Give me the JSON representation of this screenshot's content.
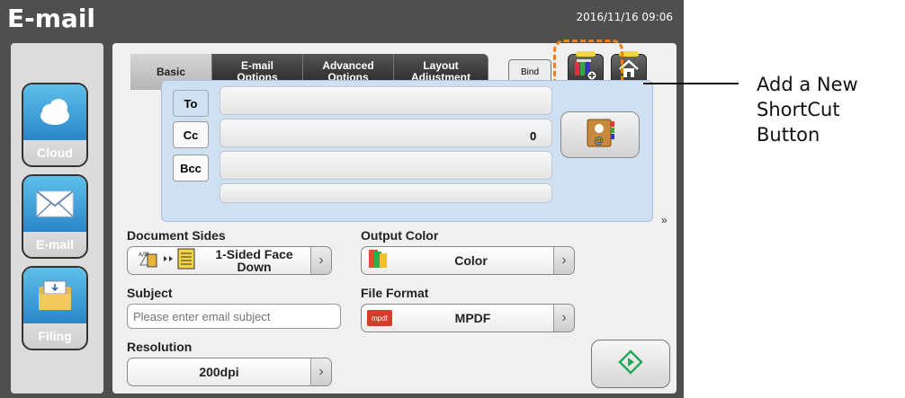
{
  "header": {
    "title": "E-mail",
    "datetime": "2016/11/16 09:06"
  },
  "sidebar": {
    "items": [
      {
        "label": "Cloud",
        "icon": "cloud-icon"
      },
      {
        "label": "E-mail",
        "icon": "envelope-icon"
      },
      {
        "label": "Filing",
        "icon": "folder-icon"
      }
    ]
  },
  "tabs": [
    {
      "label": "Basic",
      "active": true
    },
    {
      "label": "E-mail\nOptions",
      "active": false
    },
    {
      "label": "Advanced\nOptions",
      "active": false
    },
    {
      "label": "Layout\nAdjustment",
      "active": false
    }
  ],
  "toolbar": {
    "bind_label": "Bind",
    "shortcut_icon": "add-shortcut-icon",
    "home_icon": "home-icon"
  },
  "recipients": {
    "to_label": "To",
    "cc_label": "Cc",
    "bcc_label": "Bcc",
    "count": "0",
    "address_book_icon": "address-book-icon"
  },
  "document_sides": {
    "label": "Document Sides",
    "value": "1-Sided Face Down"
  },
  "output_color": {
    "label": "Output Color",
    "value": "Color"
  },
  "subject": {
    "label": "Subject",
    "placeholder": "Please enter email subject"
  },
  "file_format": {
    "label": "File Format",
    "value": "MPDF",
    "icon_text": "mpdf"
  },
  "resolution": {
    "label": "Resolution",
    "value": "200dpi"
  },
  "more_indicator": "»",
  "callout": {
    "text": "Add a New ShortCut Button"
  },
  "colors": {
    "highlight": "#ee7f1f",
    "start_green": "#27a85a",
    "tab_dark": "#2b2b2b",
    "recipient_bg": "#cfe0f2"
  }
}
